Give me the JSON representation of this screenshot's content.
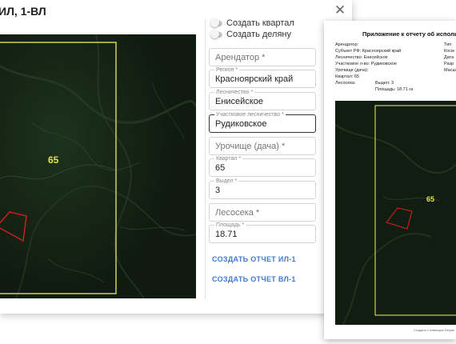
{
  "dialog": {
    "title": "ИЛ, 1-ВЛ",
    "close_icon": "close-icon"
  },
  "map": {
    "quarter_label": "65",
    "boundary_color": "#e0e050",
    "plot_color": "#e02020"
  },
  "toggles": [
    {
      "label": "Создать квартал",
      "on": false
    },
    {
      "label": "Создать деляну",
      "on": false
    }
  ],
  "form": {
    "tenant": {
      "placeholder": "Арендатор *"
    },
    "region": {
      "label": "Регион *",
      "value": "Красноярский край"
    },
    "forestry": {
      "label": "Лесничество *",
      "value": "Енисейское"
    },
    "district_forestry": {
      "label": "Участковое лесничество *",
      "value": "Рудиковское"
    },
    "tract": {
      "placeholder": "Урочище (дача) *"
    },
    "quarter": {
      "label": "Квартал *",
      "value": "65"
    },
    "allotment": {
      "label": "Выдел *",
      "value": "3"
    },
    "cutting_area": {
      "placeholder": "Лесосека *"
    },
    "area": {
      "label": "Площадь *",
      "value": "18.71"
    }
  },
  "actions": {
    "report_il": "СОЗДАТЬ ОТЧЕТ ИЛ-1",
    "report_vl": "СОЗДАТЬ ОТЧЕТ ВЛ-1"
  },
  "report": {
    "title": "Приложение к отчету об использ",
    "left_lines": [
      "Арендатор:",
      "Субъект РФ: Красноярский край",
      "Лесничество: Енисейское",
      "Участковое л-во: Рудиковское",
      "Урочище (дача):",
      "Квартал: 65",
      "Лесосека:"
    ],
    "mid_lines": [
      "Выдел: 3",
      "Площадь: 18.71 га"
    ],
    "right_lines": [
      "Тип",
      "Косм",
      "Дата",
      "Разр",
      "Масш"
    ],
    "map_label": "65",
    "footer": "Создано с помощью Delyan"
  }
}
